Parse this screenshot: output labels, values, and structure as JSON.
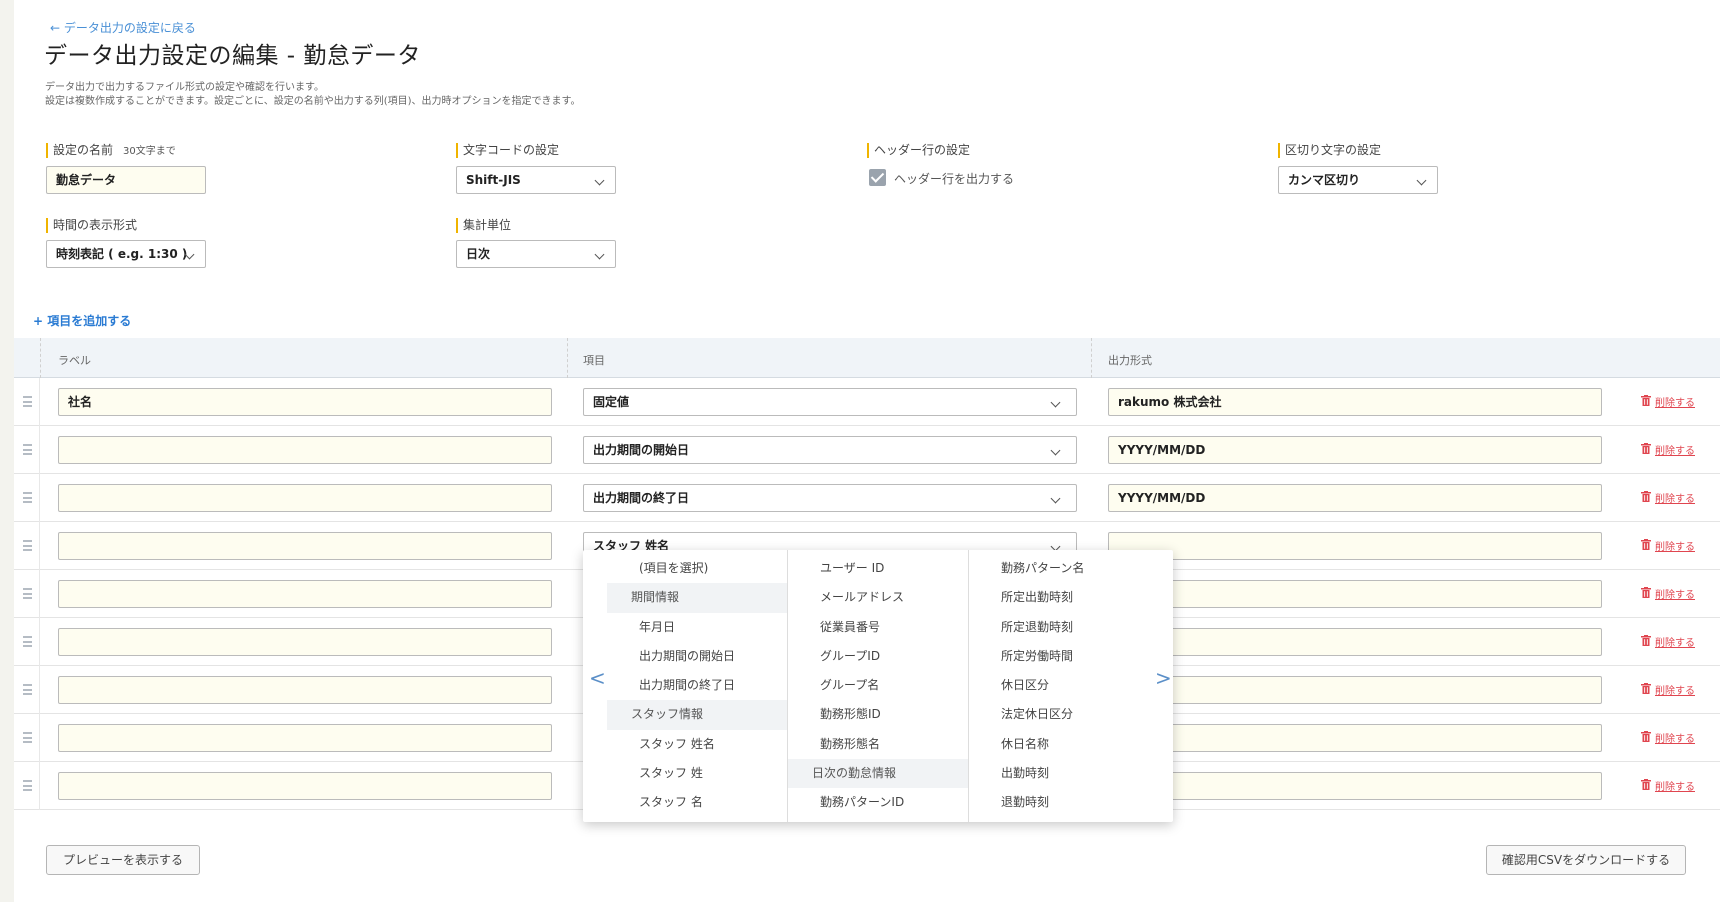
{
  "header": {
    "back_link": "← データ出力の設定に戻る",
    "title": "データ出力設定の編集 - 勤怠データ",
    "description": [
      "データ出力で出力するファイル形式の設定や確認を行います。",
      "設定は複数作成することができます。設定ごとに、設定の名前や出力する列(項目)、出力時オプションを指定できます。"
    ]
  },
  "settings": {
    "name": {
      "label": "設定の名前",
      "hint": "30文字まで",
      "value": "勤怠データ"
    },
    "encoding": {
      "label": "文字コードの設定",
      "value": "Shift-JIS"
    },
    "header_row": {
      "label": "ヘッダー行の設定",
      "checkbox_label": "ヘッダー行を出力する",
      "checked": true
    },
    "delimiter": {
      "label": "区切り文字の設定",
      "value": "カンマ区切り"
    },
    "time_format": {
      "label": "時間の表示形式",
      "value": "時刻表記 ( e.g. 1:30 )"
    },
    "aggregation": {
      "label": "集計単位",
      "value": "日次"
    }
  },
  "add_item_label": "+ 項目を追加する",
  "table": {
    "columns": [
      "ラベル",
      "項目",
      "出力形式"
    ],
    "delete_label": "削除する",
    "rows": [
      {
        "label": "社名",
        "item": "固定値",
        "format": "rakumo 株式会社"
      },
      {
        "label": "",
        "item": "出力期間の開始日",
        "format": "YYYY/MM/DD"
      },
      {
        "label": "",
        "item": "出力期間の終了日",
        "format": "YYYY/MM/DD"
      },
      {
        "label": "",
        "item": "スタッフ 姓名",
        "format": ""
      },
      {
        "label": "",
        "item": "",
        "format": ""
      },
      {
        "label": "",
        "item": "",
        "format": ""
      },
      {
        "label": "",
        "item": "",
        "format": ""
      },
      {
        "label": "",
        "item": "",
        "format": ""
      },
      {
        "label": "",
        "item": "",
        "format": ""
      }
    ]
  },
  "dropdown": {
    "prev_arrow": "<",
    "next_arrow": ">",
    "col1": [
      {
        "text": "(項目を選択)",
        "group": false
      },
      {
        "text": "期間情報",
        "group": true
      },
      {
        "text": "年月日",
        "group": false
      },
      {
        "text": "出力期間の開始日",
        "group": false
      },
      {
        "text": "出力期間の終了日",
        "group": false
      },
      {
        "text": "スタッフ情報",
        "group": true
      },
      {
        "text": "スタッフ 姓名",
        "group": false
      },
      {
        "text": "スタッフ 姓",
        "group": false
      },
      {
        "text": "スタッフ 名",
        "group": false
      }
    ],
    "col2": [
      {
        "text": "ユーザー ID",
        "group": false
      },
      {
        "text": "メールアドレス",
        "group": false
      },
      {
        "text": "従業員番号",
        "group": false
      },
      {
        "text": "グループID",
        "group": false
      },
      {
        "text": "グループ名",
        "group": false
      },
      {
        "text": "勤務形態ID",
        "group": false
      },
      {
        "text": "勤務形態名",
        "group": false
      },
      {
        "text": "日次の勤怠情報",
        "group": true
      },
      {
        "text": "勤務パターンID",
        "group": false
      }
    ],
    "col3": [
      {
        "text": "勤務パターン名",
        "group": false
      },
      {
        "text": "所定出勤時刻",
        "group": false
      },
      {
        "text": "所定退勤時刻",
        "group": false
      },
      {
        "text": "所定労働時間",
        "group": false
      },
      {
        "text": "休日区分",
        "group": false
      },
      {
        "text": "法定休日区分",
        "group": false
      },
      {
        "text": "休日名称",
        "group": false
      },
      {
        "text": "出勤時刻",
        "group": false
      },
      {
        "text": "退勤時刻",
        "group": false
      }
    ]
  },
  "footer": {
    "preview_button": "プレビューを表示する",
    "download_button": "確認用CSVをダウンロードする"
  },
  "colors": {
    "accent": "#2a7bd3",
    "required_bar": "#f0b400",
    "delete": "#e0454f",
    "input_bg": "#fefdf0"
  }
}
